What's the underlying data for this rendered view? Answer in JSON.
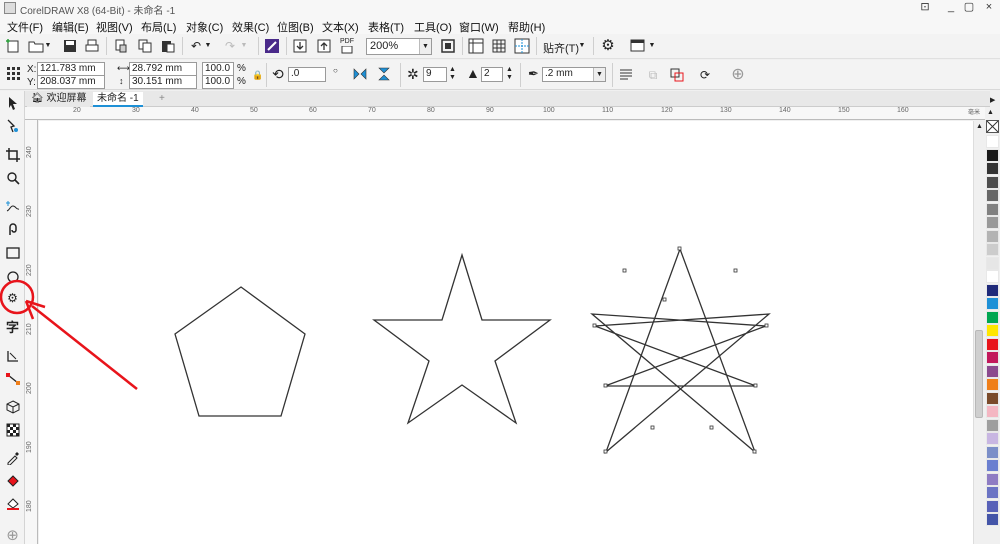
{
  "window": {
    "title": "CorelDRAW X8 (64-Bit) - 未命名 -1",
    "controls": [
      "_",
      "▢",
      "×"
    ]
  },
  "menu": [
    "文件(F)",
    "编辑(E)",
    "视图(V)",
    "布局(L)",
    "对象(C)",
    "效果(C)",
    "位图(B)",
    "文本(X)",
    "表格(T)",
    "工具(O)",
    "窗口(W)",
    "帮助(H)"
  ],
  "toolbar": {
    "zoom": "200%",
    "pdf_label": "PDF",
    "snap_label": "贴齐(T)"
  },
  "properties": {
    "x": "121.783 mm",
    "y": "208.037 mm",
    "x_label": "X:",
    "y_label": "Y:",
    "width": "28.792 mm",
    "height": "30.151 mm",
    "scale_w": "100.0",
    "scale_h": "100.0",
    "pct": "%",
    "rotation": ".0",
    "points": "9",
    "sharpness": "2",
    "outline": ".2 mm"
  },
  "tabs": {
    "welcome": "欢迎屏幕",
    "doc": "未命名 -1",
    "add": "+"
  },
  "ruler": {
    "h": [
      "20",
      "30",
      "40",
      "50",
      "60",
      "70",
      "80",
      "90",
      "100",
      "110",
      "120",
      "130",
      "140",
      "150",
      "160"
    ],
    "v": [
      "240",
      "230",
      "220",
      "210",
      "200",
      "190",
      "180",
      "170"
    ],
    "unit": "毫米"
  },
  "toolbox": [
    "pick-tool",
    "shape-tool",
    "crop-tool",
    "zoom-tool",
    "freehand-tool",
    "artistic-media-tool",
    "rectangle-tool",
    "ellipse-tool",
    "polygon-tool",
    "text-tool",
    "parallel-dimension-tool",
    "connector-tool",
    "extrude-tool",
    "transparency-tool",
    "eyedropper-tool",
    "interactive-fill-tool",
    "smart-fill-tool",
    "add-tool"
  ],
  "palette": [
    "#ffffff",
    "#1a1a1a",
    "#333333",
    "#4d4d4d",
    "#666666",
    "#808080",
    "#999999",
    "#b3b3b3",
    "#cccccc",
    "#e6e6e6",
    "#ffffff",
    "#1f2a7a",
    "#1e90d6",
    "#00a651",
    "#ffe600",
    "#e8141b",
    "#c2185b",
    "#8b4a8e",
    "#ef7f1a",
    "#7a4a2a",
    "#f4b6c2",
    "#9e9e9e",
    "#c8b6e2",
    "#7b8ec8",
    "#6a7fd0",
    "#8e7cc3",
    "#6b74c4",
    "#5861b8",
    "#4455a8"
  ],
  "accent": {
    "annotation": "#e8141b",
    "selection": "#1e90d6"
  }
}
